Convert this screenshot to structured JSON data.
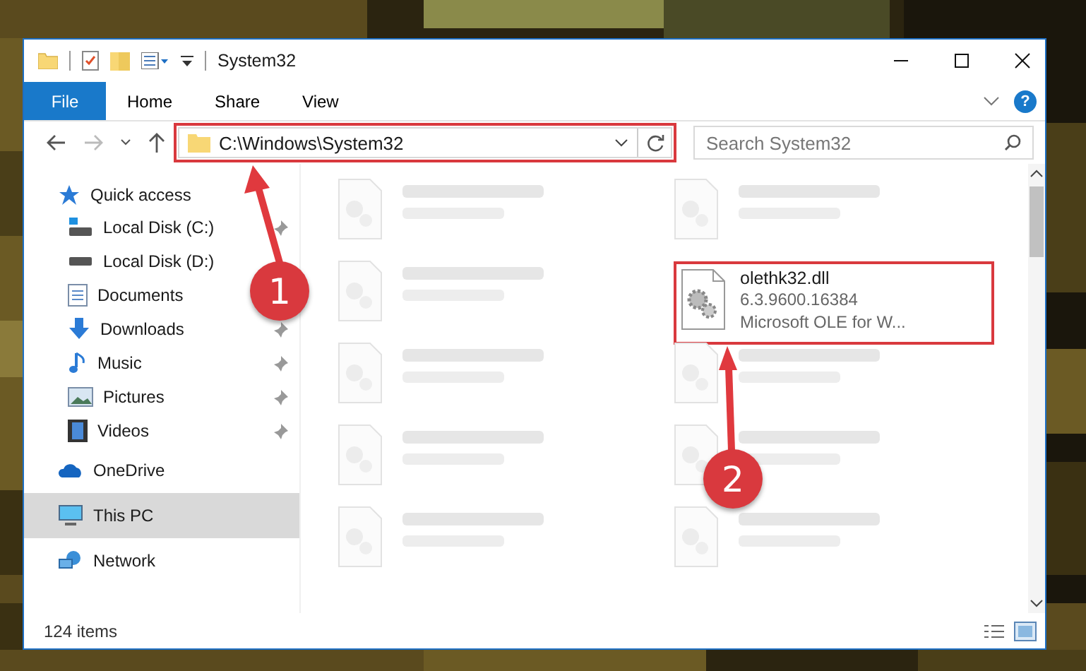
{
  "window": {
    "title": "System32"
  },
  "file_menu": "File",
  "ribbon_tabs": [
    "Home",
    "Share",
    "View"
  ],
  "help_button": "?",
  "address": {
    "path": "C:\\Windows\\System32"
  },
  "search": {
    "placeholder": "Search System32"
  },
  "sidebar": {
    "items": [
      {
        "label": "Quick access",
        "kind": "star",
        "selected": false,
        "children": [
          {
            "label": "Local Disk (C:)",
            "kind": "drive-win",
            "selected": false,
            "pinned": true
          },
          {
            "label": "Local Disk (D:)",
            "kind": "drive",
            "selected": false
          },
          {
            "label": "Documents",
            "kind": "documents",
            "selected": false
          },
          {
            "label": "Downloads",
            "kind": "downloads",
            "selected": false,
            "pinned": true
          },
          {
            "label": "Music",
            "kind": "music",
            "selected": false,
            "pinned": true
          },
          {
            "label": "Pictures",
            "kind": "pictures",
            "selected": false,
            "pinned": true
          },
          {
            "label": "Videos",
            "kind": "videos",
            "selected": false,
            "pinned": true
          }
        ]
      },
      {
        "label": "OneDrive",
        "kind": "cloud",
        "selected": false
      },
      {
        "label": "This PC",
        "kind": "pc",
        "selected": true
      },
      {
        "label": "Network",
        "kind": "network",
        "selected": false
      }
    ]
  },
  "files": [
    {
      "kind": "blurred"
    },
    {
      "kind": "blurred"
    },
    {
      "kind": "blurred"
    },
    {
      "kind": "file",
      "name": "olethk32.dll",
      "lines": [
        "6.3.9600.16384",
        "Microsoft OLE for W..."
      ]
    },
    {
      "kind": "blurred"
    },
    {
      "kind": "blurred"
    },
    {
      "kind": "blurred"
    },
    {
      "kind": "blurred"
    },
    {
      "kind": "blurred"
    },
    {
      "kind": "blurred"
    }
  ],
  "status_bar": {
    "count": "124 items"
  },
  "annotations": [
    {
      "number": "1"
    },
    {
      "number": "2"
    }
  ]
}
